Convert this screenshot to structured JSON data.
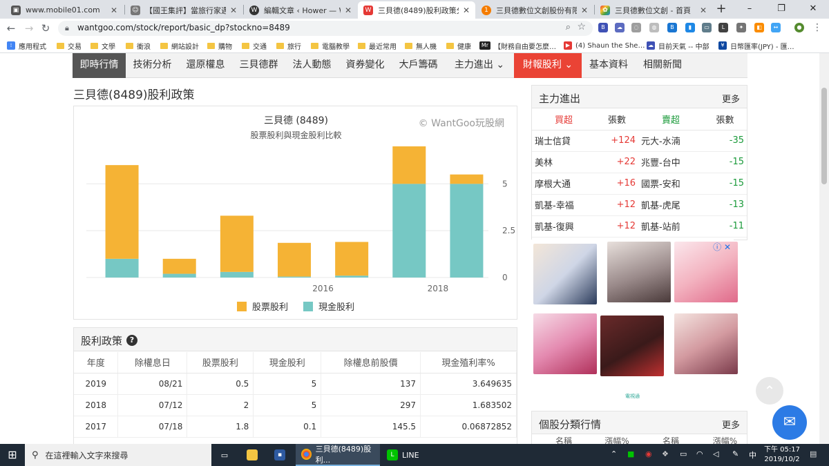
{
  "browser": {
    "tabs": [
      {
        "title": "www.mobile01.com",
        "icon": "mobile01-icon",
        "color": "#555555"
      },
      {
        "title": "【國王集評】當旅行家遇上僑…",
        "icon": "pet-icon",
        "color": "#666666"
      },
      {
        "title": "編輯文章 ‹ Hower — WordPress",
        "icon": "wordpress-icon",
        "color": "#21759b"
      },
      {
        "title": "三貝德(8489)股利政策分析 |",
        "icon": "wantgoo-icon",
        "color": "#e53935",
        "active": true
      },
      {
        "title": "三貝德數位文創股份有限公司",
        "icon": "104-icon",
        "color": "#f57c00"
      },
      {
        "title": "三貝德數位文創 - 首頁",
        "icon": "colorful-icon",
        "color": "#4caf50"
      }
    ],
    "new_tab": "+",
    "url": "wantgoo.com/stock/report/basic_dp?stockno=8489",
    "window_controls": [
      "–",
      "❐",
      "✕"
    ],
    "bookmarks": [
      {
        "label": "應用程式",
        "type": "apps"
      },
      {
        "label": "交易",
        "type": "folder"
      },
      {
        "label": "文學",
        "type": "folder"
      },
      {
        "label": "衝浪",
        "type": "folder"
      },
      {
        "label": "網站設計",
        "type": "folder"
      },
      {
        "label": "購物",
        "type": "folder"
      },
      {
        "label": "交通",
        "type": "folder"
      },
      {
        "label": "旅行",
        "type": "folder"
      },
      {
        "label": "電腦教學",
        "type": "folder"
      },
      {
        "label": "最近常用",
        "type": "folder"
      },
      {
        "label": "無人機",
        "type": "folder"
      },
      {
        "label": "健康",
        "type": "folder"
      },
      {
        "label": "【財務自由要怎麼…",
        "type": "mr"
      },
      {
        "label": "(4) Shaun the She…",
        "type": "youtube"
      },
      {
        "label": "目前天氣 -- 中部",
        "type": "weather"
      },
      {
        "label": "日幣匯率(JPY) - 匯…",
        "type": "currency"
      }
    ]
  },
  "menu": [
    "即時行情",
    "技術分析",
    "還原權息",
    "三貝德群",
    "法人動態",
    "資券變化",
    "大戶籌碼",
    "主力進出 ⌄",
    "財報股利 ⌄",
    "基本資料",
    "相關新聞"
  ],
  "page_title": "三貝德(8489)股利政策",
  "chart": {
    "title": "三貝德 (8489)",
    "subtitle": "股票股利與現金股利比較",
    "watermark": "© WantGoo玩股網",
    "legend_stock": "股票股利",
    "legend_cash": "現金股利",
    "color_stock": "#f5b335",
    "color_cash": "#76c8c4"
  },
  "chart_data": {
    "type": "bar",
    "stacked": true,
    "categories": [
      "2013",
      "2014",
      "2015",
      "2016",
      "2017",
      "2018",
      "2019"
    ],
    "x_tick_labels": [
      {
        "index": 3,
        "label": "2016"
      },
      {
        "index": 5,
        "label": "2018"
      }
    ],
    "series": [
      {
        "name": "現金股利",
        "values": [
          1.0,
          0.2,
          0.3,
          0.05,
          0.1,
          5.0,
          5.0
        ]
      },
      {
        "name": "股票股利",
        "values": [
          5.0,
          0.8,
          3.0,
          1.8,
          1.8,
          2.0,
          0.5
        ]
      }
    ],
    "ylim": [
      0,
      7
    ],
    "yticks": [
      "0",
      "2.5",
      "5"
    ],
    "y_axis_side": "right",
    "legend_position": "bottom"
  },
  "dividend_panel": {
    "title": "股利政策",
    "help": "?",
    "headers": [
      "年度",
      "除權息日",
      "股票股利",
      "現金股利",
      "除權息前股價",
      "現金殖利率%"
    ],
    "rows": [
      [
        "2019",
        "08/21",
        "0.5",
        "5",
        "137",
        "3.649635"
      ],
      [
        "2018",
        "07/12",
        "2",
        "5",
        "297",
        "1.683502"
      ],
      [
        "2017",
        "07/18",
        "1.8",
        "0.1",
        "145.5",
        "0.06872852"
      ]
    ]
  },
  "main_force": {
    "title": "主力進出",
    "more": "更多",
    "headers": [
      "買超",
      "張數",
      "賣超",
      "張數"
    ],
    "rows": [
      [
        "瑞士信貸",
        "+124",
        "元大-水湳",
        "-35"
      ],
      [
        "美林",
        "+22",
        "兆豐-台中",
        "-15"
      ],
      [
        "摩根大通",
        "+16",
        "國票-安和",
        "-15"
      ],
      [
        "凱基-幸福",
        "+12",
        "凱基-虎尾",
        "-13"
      ],
      [
        "凱基-復興",
        "+12",
        "凱基-站前",
        "-11"
      ]
    ]
  },
  "ads": {
    "close": "ⓘ ✕",
    "logo": "電視通"
  },
  "sector": {
    "title": "個股分類行情",
    "more": "更多",
    "subheaders": [
      "名稱",
      "漲幅%",
      "名稱",
      "漲幅%"
    ]
  },
  "taskbar": {
    "search_placeholder": "在這裡輸入文字來搜尋",
    "chrome_item": "三貝德(8489)股利...",
    "line_item": "LINE",
    "time": "下午 05:17",
    "date": "2019/10/2"
  }
}
